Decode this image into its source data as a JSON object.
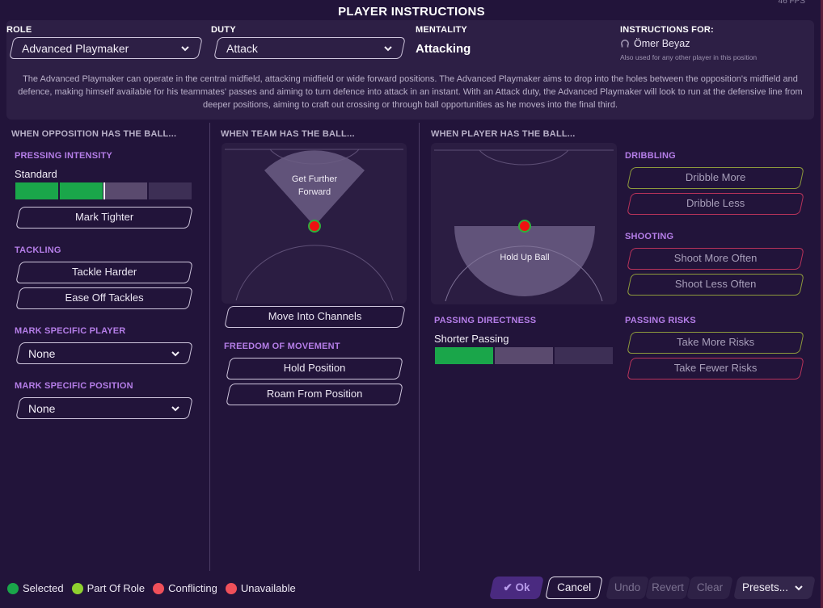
{
  "window": {
    "title": "PLAYER INSTRUCTIONS",
    "fps": "46 FPS"
  },
  "header": {
    "role": {
      "label": "ROLE",
      "value": "Advanced Playmaker"
    },
    "duty": {
      "label": "DUTY",
      "value": "Attack"
    },
    "mentality": {
      "label": "MENTALITY",
      "value": "Attacking"
    },
    "instructions_for": {
      "label": "INSTRUCTIONS FOR:",
      "player": "Ömer Beyaz",
      "note": "Also used for any other player in this position"
    },
    "description": "The Advanced Playmaker can operate in the central midfield, attacking midfield or wide forward positions. The Advanced Playmaker aims to drop into the holes between the opposition's midfield and defence, making himself available for his teammates' passes and aiming to turn defence into attack in an instant. With an Attack duty, the Advanced Playmaker will look to run at the defensive line from deeper positions, aiming to craft out crossing or through ball opportunities as he moves into the final third."
  },
  "opposition": {
    "title": "WHEN OPPOSITION HAS THE BALL...",
    "pressing": {
      "label": "PRESSING INTENSITY",
      "value": "Standard",
      "segments": 4,
      "filled": 2
    },
    "mark_tighter": "Mark Tighter",
    "tackling": {
      "label": "TACKLING",
      "harder": "Tackle Harder",
      "ease": "Ease Off Tackles"
    },
    "mark_player": {
      "label": "MARK SPECIFIC PLAYER",
      "value": "None"
    },
    "mark_position": {
      "label": "MARK SPECIFIC POSITION",
      "value": "None"
    }
  },
  "team": {
    "title": "WHEN TEAM HAS THE BALL...",
    "zone_label_1": "Get Further",
    "zone_label_2": "Forward",
    "channels": "Move Into Channels",
    "freedom": {
      "label": "FREEDOM OF MOVEMENT",
      "hold": "Hold Position",
      "roam": "Roam From Position"
    }
  },
  "player": {
    "title": "WHEN PLAYER HAS THE BALL...",
    "zone_label": "Hold Up Ball",
    "passing_directness": {
      "label": "PASSING DIRECTNESS",
      "value": "Shorter Passing",
      "segments": 3,
      "filled": 1
    },
    "dribbling": {
      "label": "DRIBBLING",
      "more": "Dribble More",
      "less": "Dribble Less"
    },
    "shooting": {
      "label": "SHOOTING",
      "more": "Shoot More Often",
      "less": "Shoot Less Often"
    },
    "passing_risks": {
      "label": "PASSING RISKS",
      "more": "Take More Risks",
      "fewer": "Take Fewer Risks"
    }
  },
  "legend": {
    "selected": "Selected",
    "part_of_role": "Part Of Role",
    "conflicting": "Conflicting",
    "unavailable": "Unavailable"
  },
  "footer": {
    "ok": "Ok",
    "cancel": "Cancel",
    "undo": "Undo",
    "revert": "Revert",
    "clear": "Clear",
    "presets": "Presets..."
  },
  "colors": {
    "selected": "#1aa64a",
    "part_of_role": "#8fd12f",
    "conflicting": "#f0505a",
    "unavailable": "#f0505a",
    "accent": "#b57ee8"
  }
}
